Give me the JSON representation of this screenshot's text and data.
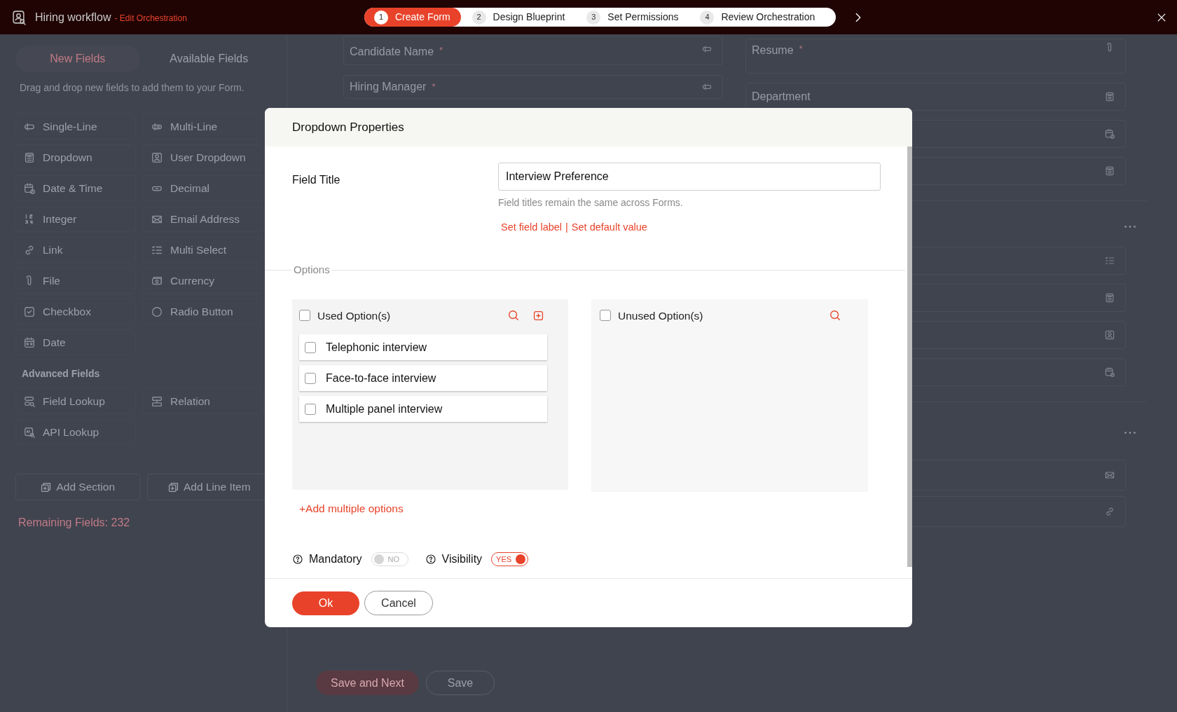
{
  "app_bar": {
    "title": "Hiring workflow",
    "subtitle": "- Edit Orchestration",
    "steps": [
      {
        "number": "1",
        "label": "Create Form",
        "selected": true
      },
      {
        "number": "2",
        "label": "Design Blueprint",
        "selected": false
      },
      {
        "number": "3",
        "label": "Set Permissions",
        "selected": false
      },
      {
        "number": "4",
        "label": "Review Orchestration",
        "selected": false
      }
    ]
  },
  "field_palette": {
    "tabs": [
      {
        "label": "New Fields",
        "selected": true
      },
      {
        "label": "Available Fields",
        "selected": false
      }
    ],
    "hint": "Drag and drop new fields to add them to your Form.",
    "fields": [
      {
        "label": "Single-Line"
      },
      {
        "label": "Multi-Line"
      },
      {
        "label": "Dropdown"
      },
      {
        "label": "User Dropdown"
      },
      {
        "label": "Date & Time"
      },
      {
        "label": "Decimal"
      },
      {
        "label": "Integer"
      },
      {
        "label": "Email Address"
      },
      {
        "label": "Link"
      },
      {
        "label": "Multi Select"
      },
      {
        "label": "File"
      },
      {
        "label": "Currency"
      },
      {
        "label": "Checkbox"
      },
      {
        "label": "Radio Button"
      },
      {
        "label": "Date"
      }
    ],
    "advanced_heading": "Advanced Fields",
    "advanced_fields": [
      {
        "label": "Field Lookup"
      },
      {
        "label": "Relation"
      },
      {
        "label": "API Lookup"
      }
    ],
    "actions": [
      "Add Section",
      "Add Line Item"
    ],
    "remaining": "Remaining Fields: 232"
  },
  "form": {
    "left_fields": [
      {
        "label": "Candidate Name",
        "required_mark": "*"
      },
      {
        "label": "Hiring Manager",
        "required_mark": "*"
      }
    ],
    "right_fields": [
      {
        "label": "Resume",
        "required_mark": "*"
      },
      {
        "label": "Department"
      }
    ],
    "buttons": [
      "Save and Next",
      "Save"
    ]
  },
  "dialog": {
    "title": "Dropdown Properties",
    "field_title_label": "Field Title",
    "field_title_value": "Interview Preference",
    "field_title_hint": "Field titles remain the same across Forms.",
    "links": [
      "Set field label",
      "Set default value"
    ],
    "link_separator": "|",
    "options_legend": "Options",
    "used": {
      "label": "Used Option(s)",
      "checked": false,
      "items": [
        {
          "label": "Telephonic interview",
          "checked": false
        },
        {
          "label": "Face-to-face interview",
          "checked": false
        },
        {
          "label": "Multiple panel interview",
          "checked": false
        }
      ]
    },
    "unused": {
      "label": "Unused Option(s)",
      "checked": false
    },
    "add_multiple": "+Add multiple options",
    "toggles": [
      {
        "label": "Mandatory",
        "on": false,
        "text": "NO"
      },
      {
        "label": "Visibility",
        "on": true,
        "text": "YES"
      }
    ],
    "buttons": [
      {
        "label": "Ok",
        "kind": "primary"
      },
      {
        "label": "Cancel",
        "kind": "secondary"
      }
    ]
  }
}
